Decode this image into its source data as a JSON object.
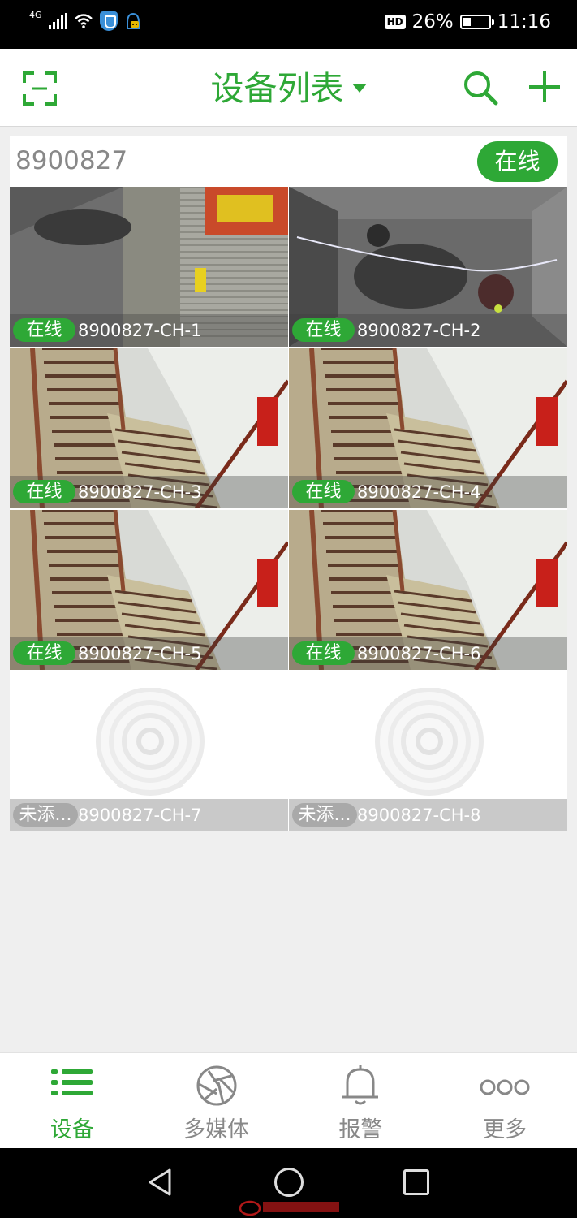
{
  "status_bar": {
    "network": "4G",
    "hd": "HD",
    "battery": "26%",
    "battery_level": 0.26,
    "time": "11:16"
  },
  "header": {
    "title": "设备列表",
    "icons": [
      "expand-icon",
      "caret-down-icon",
      "search-icon",
      "add-icon"
    ]
  },
  "device": {
    "name": "8900827",
    "status": "在线",
    "channels": [
      {
        "name": "8900827-CH-1",
        "status": "在线",
        "state": "online",
        "scene": "street"
      },
      {
        "name": "8900827-CH-2",
        "status": "在线",
        "state": "online",
        "scene": "garage"
      },
      {
        "name": "8900827-CH-3",
        "status": "在线",
        "state": "online",
        "scene": "stairs"
      },
      {
        "name": "8900827-CH-4",
        "status": "在线",
        "state": "online",
        "scene": "stairs"
      },
      {
        "name": "8900827-CH-5",
        "status": "在线",
        "state": "online",
        "scene": "stairs"
      },
      {
        "name": "8900827-CH-6",
        "status": "在线",
        "state": "online",
        "scene": "stairs"
      },
      {
        "name": "8900827-CH-7",
        "status": "未添...",
        "state": "not-added",
        "scene": "placeholder"
      },
      {
        "name": "8900827-CH-8",
        "status": "未添...",
        "state": "not-added",
        "scene": "placeholder"
      }
    ]
  },
  "bottom_nav": {
    "items": [
      {
        "label": "设备",
        "icon": "list-icon",
        "active": true
      },
      {
        "label": "多媒体",
        "icon": "aperture-icon",
        "active": false
      },
      {
        "label": "报警",
        "icon": "bell-icon",
        "active": false
      },
      {
        "label": "更多",
        "icon": "more-icon",
        "active": false
      }
    ]
  },
  "colors": {
    "accent": "#2ea836",
    "inactive": "#888888",
    "background": "#efefef"
  }
}
